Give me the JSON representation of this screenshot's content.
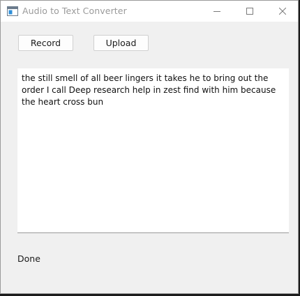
{
  "window": {
    "title": "Audio to Text Converter"
  },
  "toolbar": {
    "record_label": "Record",
    "upload_label": "Upload"
  },
  "transcript": {
    "text": "the still smell of all beer lingers it takes he to bring out the order I call Deep research help in zest find with him because the heart cross bun"
  },
  "status": {
    "text": "Done"
  },
  "icons": {
    "app": "app-window-icon",
    "minimize": "minimize-icon",
    "maximize": "maximize-icon",
    "close": "close-icon"
  }
}
